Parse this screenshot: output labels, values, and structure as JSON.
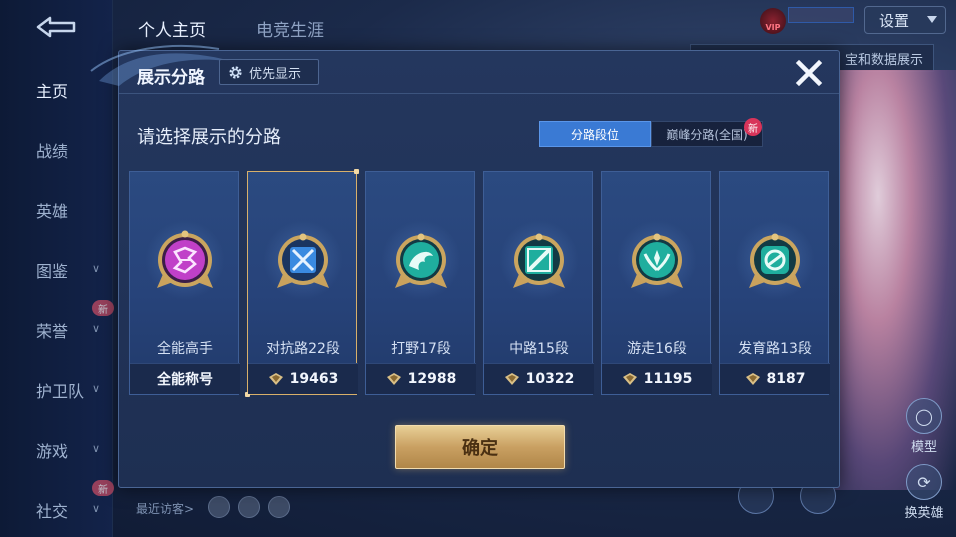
{
  "top_tabs": [
    {
      "label": "个人主页",
      "active": true
    },
    {
      "label": "电竞生涯",
      "active": false
    }
  ],
  "sidebar": {
    "items": [
      {
        "label": "主页",
        "active": true,
        "chevron": false,
        "new": false
      },
      {
        "label": "战绩",
        "active": false,
        "chevron": false,
        "new": false
      },
      {
        "label": "英雄",
        "active": false,
        "chevron": false,
        "new": false
      },
      {
        "label": "图鉴",
        "active": false,
        "chevron": true,
        "new": false
      },
      {
        "label": "荣誉",
        "active": false,
        "chevron": true,
        "new": true
      },
      {
        "label": "护卫队",
        "active": false,
        "chevron": true,
        "new": false
      },
      {
        "label": "游戏",
        "active": false,
        "chevron": true,
        "new": false
      },
      {
        "label": "社交",
        "active": false,
        "chevron": true,
        "new": true
      }
    ],
    "new_tag": "新"
  },
  "header_right": {
    "settings_label": "设置",
    "vip_label": "VIP",
    "banner_text": "宝和数据展示"
  },
  "background": {
    "recent_visitors_label": "最近访客>",
    "model_label": "模型",
    "switch_hero_label": "换英雄"
  },
  "dialog": {
    "title": "展示分路",
    "priority_button": "优先显示",
    "subtitle": "请选择展示的分路",
    "toggle": {
      "option_a": "分路段位",
      "option_b": "巅峰分路(全国)",
      "selected": "option_a",
      "new_badge": "新"
    },
    "cards": [
      {
        "name": "全能高手",
        "value": "全能称号",
        "emblem": "all-round-icon",
        "color": "#c040c8",
        "selected": false
      },
      {
        "name": "对抗路22段",
        "value": "19463",
        "emblem": "clash-lane-icon",
        "color": "#3a8ae0",
        "selected": true
      },
      {
        "name": "打野17段",
        "value": "12988",
        "emblem": "jungle-icon",
        "color": "#1fae9e",
        "selected": false
      },
      {
        "name": "中路15段",
        "value": "10322",
        "emblem": "mid-lane-icon",
        "color": "#1fae9e",
        "selected": false
      },
      {
        "name": "游走16段",
        "value": "11195",
        "emblem": "roam-icon",
        "color": "#1fae9e",
        "selected": false
      },
      {
        "name": "发育路13段",
        "value": "8187",
        "emblem": "farm-lane-icon",
        "color": "#1fae9e",
        "selected": false
      }
    ],
    "confirm_button": "确定"
  }
}
